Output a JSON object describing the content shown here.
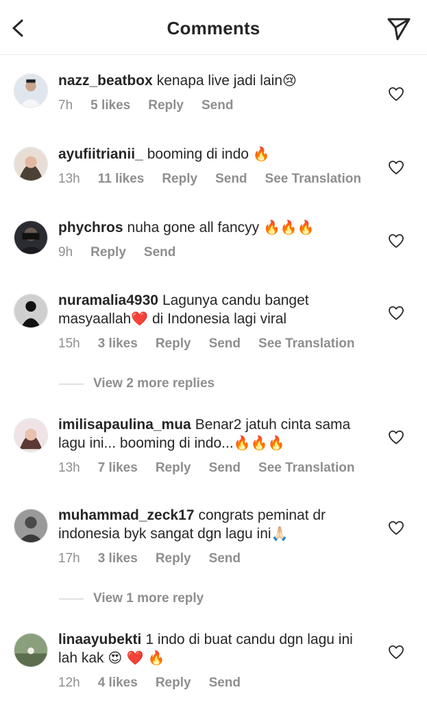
{
  "header": {
    "title": "Comments"
  },
  "comments": [
    {
      "user": "nazz_beatbox",
      "text": "kenapa live jadi lain",
      "emoji": "😢",
      "time": "7h",
      "likes": "5 likes",
      "reply": "Reply",
      "send": "Send",
      "translate": ""
    },
    {
      "user": "ayufiitrianii_",
      "text": "booming di indo ",
      "emoji": "🔥",
      "time": "13h",
      "likes": "11 likes",
      "reply": "Reply",
      "send": "Send",
      "translate": "See Translation"
    },
    {
      "user": "phychros",
      "text": "nuha gone all fancyy ",
      "emoji": "🔥🔥🔥",
      "time": "9h",
      "likes": "",
      "reply": "Reply",
      "send": "Send",
      "translate": ""
    },
    {
      "user": "nuramalia4930",
      "text": "Lagunya candu banget masyaallah",
      "emoji": "❤️",
      "text2": " di Indonesia lagi viral",
      "time": "15h",
      "likes": "3 likes",
      "reply": "Reply",
      "send": "Send",
      "translate": "See Translation"
    },
    {
      "user": "imilisapaulina_mua",
      "text": "Benar2 jatuh cinta sama lagu ini... booming di indo...",
      "emoji": "🔥🔥🔥",
      "time": "13h",
      "likes": "7 likes",
      "reply": "Reply",
      "send": "Send",
      "translate": "See Translation"
    },
    {
      "user": "muhammad_zeck17",
      "text": "congrats peminat dr indonesia byk sangat dgn lagu ini",
      "emoji": "🙏🏻",
      "time": "17h",
      "likes": "3 likes",
      "reply": "Reply",
      "send": "Send",
      "translate": ""
    },
    {
      "user": "linaayubekti",
      "text": "1 indo di buat candu dgn lagu ini lah kak ",
      "emoji": "😍 ❤️ 🔥",
      "time": "12h",
      "likes": "4 likes",
      "reply": "Reply",
      "send": "Send",
      "translate": ""
    }
  ],
  "view_replies": [
    {
      "label": "View 2 more replies"
    },
    {
      "label": "View 1 more reply"
    }
  ],
  "colors": {
    "text": "#262626",
    "secondary": "#8e8e8e",
    "divider": "#ebebeb"
  }
}
